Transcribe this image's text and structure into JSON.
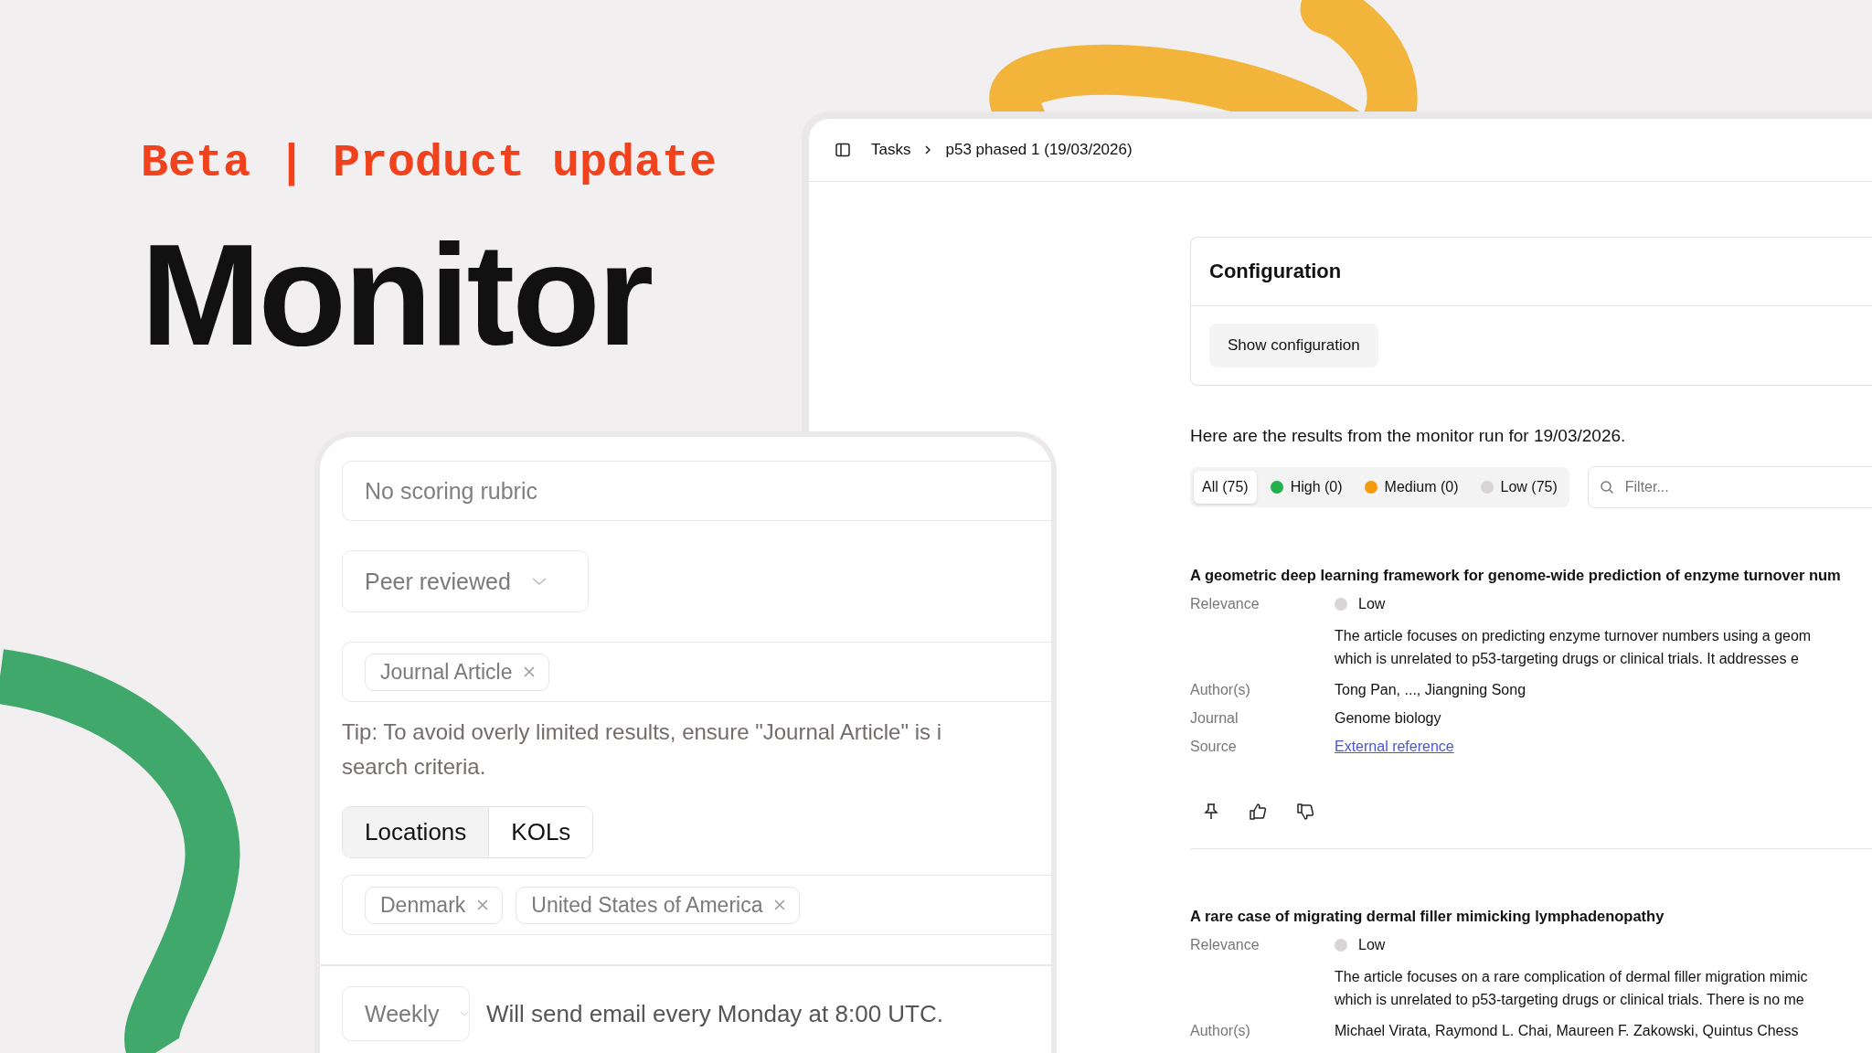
{
  "headline": {
    "kicker": "Beta | Product update",
    "title": "Monitor"
  },
  "results_window": {
    "breadcrumb": [
      "Tasks",
      "p53 phased 1 (19/03/2026)"
    ],
    "configuration": {
      "title": "Configuration",
      "button": "Show configuration"
    },
    "summary": "Here are the results from the monitor run for 19/03/2026.",
    "filters": [
      {
        "label": "All (75)",
        "selected": true
      },
      {
        "label": "High (0)",
        "selected": false,
        "color": "#22b14c"
      },
      {
        "label": "Medium (0)",
        "selected": false,
        "color": "#f59a0c"
      },
      {
        "label": "Low (75)",
        "selected": false,
        "color": "#d9d4d6"
      }
    ],
    "filter_placeholder": "Filter...",
    "articles": [
      {
        "title": "A geometric deep learning framework for genome-wide prediction of enzyme turnover num",
        "relevance": {
          "label": "Relevance",
          "value": "Low",
          "color": "#d9d4d6"
        },
        "summary": [
          "The article focuses on predicting enzyme turnover numbers using a geom",
          "which is unrelated to p53-targeting drugs or clinical trials. It addresses e"
        ],
        "fields": [
          {
            "label": "Author(s)",
            "value": "Tong Pan, ..., Jiangning Song",
            "kind": "text"
          },
          {
            "label": "Journal",
            "value": "Genome biology",
            "kind": "text"
          },
          {
            "label": "Source",
            "value": "External reference",
            "kind": "link"
          }
        ]
      },
      {
        "title": "A rare case of migrating dermal filler mimicking lymphadenopathy",
        "relevance": {
          "label": "Relevance",
          "value": "Low",
          "color": "#d9d4d6"
        },
        "summary": [
          "The article focuses on a rare complication of dermal filler migration mimic",
          "which is unrelated to p53-targeting drugs or clinical trials. There is no me"
        ],
        "fields": [
          {
            "label": "Author(s)",
            "value": "Michael Virata, Raymond L. Chai, Maureen F. Zakowski, Quintus Chess",
            "kind": "text"
          }
        ]
      }
    ]
  },
  "settings_card": {
    "rubric_placeholder": "No scoring rubric",
    "review_select": "Peer reviewed",
    "type_tags": [
      "Journal Article"
    ],
    "tip_lines": [
      "Tip: To avoid overly limited results, ensure \"Journal Article\" is i",
      "search criteria."
    ],
    "tabs": [
      {
        "label": "Locations",
        "selected": true
      },
      {
        "label": "KOLs",
        "selected": false
      }
    ],
    "location_tags": [
      "Denmark",
      "United States of America"
    ],
    "frequency_select": "Weekly",
    "schedule_note": "Will send email every Monday at 8:00 UTC."
  }
}
